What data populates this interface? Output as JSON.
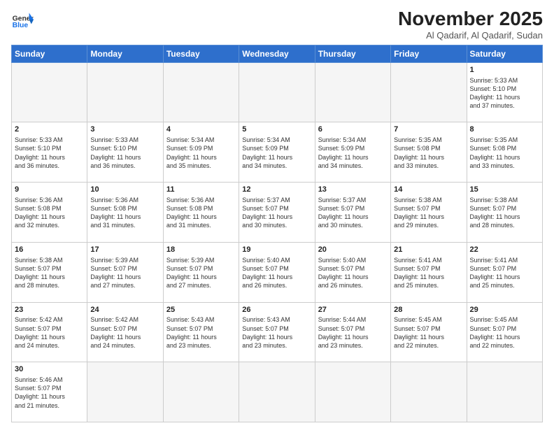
{
  "logo": {
    "general": "General",
    "blue": "Blue"
  },
  "header": {
    "month_year": "November 2025",
    "location": "Al Qadarif, Al Qadarif, Sudan"
  },
  "weekdays": [
    "Sunday",
    "Monday",
    "Tuesday",
    "Wednesday",
    "Thursday",
    "Friday",
    "Saturday"
  ],
  "weeks": [
    [
      {
        "day": "",
        "text": "",
        "empty": true
      },
      {
        "day": "",
        "text": "",
        "empty": true
      },
      {
        "day": "",
        "text": "",
        "empty": true
      },
      {
        "day": "",
        "text": "",
        "empty": true
      },
      {
        "day": "",
        "text": "",
        "empty": true
      },
      {
        "day": "",
        "text": "",
        "empty": true
      },
      {
        "day": "1",
        "text": "Sunrise: 5:33 AM\nSunset: 5:10 PM\nDaylight: 11 hours\nand 37 minutes."
      }
    ],
    [
      {
        "day": "2",
        "text": "Sunrise: 5:33 AM\nSunset: 5:10 PM\nDaylight: 11 hours\nand 36 minutes."
      },
      {
        "day": "3",
        "text": "Sunrise: 5:33 AM\nSunset: 5:10 PM\nDaylight: 11 hours\nand 36 minutes."
      },
      {
        "day": "4",
        "text": "Sunrise: 5:34 AM\nSunset: 5:09 PM\nDaylight: 11 hours\nand 35 minutes."
      },
      {
        "day": "5",
        "text": "Sunrise: 5:34 AM\nSunset: 5:09 PM\nDaylight: 11 hours\nand 34 minutes."
      },
      {
        "day": "6",
        "text": "Sunrise: 5:34 AM\nSunset: 5:09 PM\nDaylight: 11 hours\nand 34 minutes."
      },
      {
        "day": "7",
        "text": "Sunrise: 5:35 AM\nSunset: 5:08 PM\nDaylight: 11 hours\nand 33 minutes."
      },
      {
        "day": "8",
        "text": "Sunrise: 5:35 AM\nSunset: 5:08 PM\nDaylight: 11 hours\nand 33 minutes."
      }
    ],
    [
      {
        "day": "9",
        "text": "Sunrise: 5:36 AM\nSunset: 5:08 PM\nDaylight: 11 hours\nand 32 minutes."
      },
      {
        "day": "10",
        "text": "Sunrise: 5:36 AM\nSunset: 5:08 PM\nDaylight: 11 hours\nand 31 minutes."
      },
      {
        "day": "11",
        "text": "Sunrise: 5:36 AM\nSunset: 5:08 PM\nDaylight: 11 hours\nand 31 minutes."
      },
      {
        "day": "12",
        "text": "Sunrise: 5:37 AM\nSunset: 5:07 PM\nDaylight: 11 hours\nand 30 minutes."
      },
      {
        "day": "13",
        "text": "Sunrise: 5:37 AM\nSunset: 5:07 PM\nDaylight: 11 hours\nand 30 minutes."
      },
      {
        "day": "14",
        "text": "Sunrise: 5:38 AM\nSunset: 5:07 PM\nDaylight: 11 hours\nand 29 minutes."
      },
      {
        "day": "15",
        "text": "Sunrise: 5:38 AM\nSunset: 5:07 PM\nDaylight: 11 hours\nand 28 minutes."
      }
    ],
    [
      {
        "day": "16",
        "text": "Sunrise: 5:38 AM\nSunset: 5:07 PM\nDaylight: 11 hours\nand 28 minutes."
      },
      {
        "day": "17",
        "text": "Sunrise: 5:39 AM\nSunset: 5:07 PM\nDaylight: 11 hours\nand 27 minutes."
      },
      {
        "day": "18",
        "text": "Sunrise: 5:39 AM\nSunset: 5:07 PM\nDaylight: 11 hours\nand 27 minutes."
      },
      {
        "day": "19",
        "text": "Sunrise: 5:40 AM\nSunset: 5:07 PM\nDaylight: 11 hours\nand 26 minutes."
      },
      {
        "day": "20",
        "text": "Sunrise: 5:40 AM\nSunset: 5:07 PM\nDaylight: 11 hours\nand 26 minutes."
      },
      {
        "day": "21",
        "text": "Sunrise: 5:41 AM\nSunset: 5:07 PM\nDaylight: 11 hours\nand 25 minutes."
      },
      {
        "day": "22",
        "text": "Sunrise: 5:41 AM\nSunset: 5:07 PM\nDaylight: 11 hours\nand 25 minutes."
      }
    ],
    [
      {
        "day": "23",
        "text": "Sunrise: 5:42 AM\nSunset: 5:07 PM\nDaylight: 11 hours\nand 24 minutes."
      },
      {
        "day": "24",
        "text": "Sunrise: 5:42 AM\nSunset: 5:07 PM\nDaylight: 11 hours\nand 24 minutes."
      },
      {
        "day": "25",
        "text": "Sunrise: 5:43 AM\nSunset: 5:07 PM\nDaylight: 11 hours\nand 23 minutes."
      },
      {
        "day": "26",
        "text": "Sunrise: 5:43 AM\nSunset: 5:07 PM\nDaylight: 11 hours\nand 23 minutes."
      },
      {
        "day": "27",
        "text": "Sunrise: 5:44 AM\nSunset: 5:07 PM\nDaylight: 11 hours\nand 23 minutes."
      },
      {
        "day": "28",
        "text": "Sunrise: 5:45 AM\nSunset: 5:07 PM\nDaylight: 11 hours\nand 22 minutes."
      },
      {
        "day": "29",
        "text": "Sunrise: 5:45 AM\nSunset: 5:07 PM\nDaylight: 11 hours\nand 22 minutes."
      }
    ],
    [
      {
        "day": "30",
        "text": "Sunrise: 5:46 AM\nSunset: 5:07 PM\nDaylight: 11 hours\nand 21 minutes."
      },
      {
        "day": "",
        "text": "",
        "empty": true
      },
      {
        "day": "",
        "text": "",
        "empty": true
      },
      {
        "day": "",
        "text": "",
        "empty": true
      },
      {
        "day": "",
        "text": "",
        "empty": true
      },
      {
        "day": "",
        "text": "",
        "empty": true
      },
      {
        "day": "",
        "text": "",
        "empty": true
      }
    ]
  ]
}
